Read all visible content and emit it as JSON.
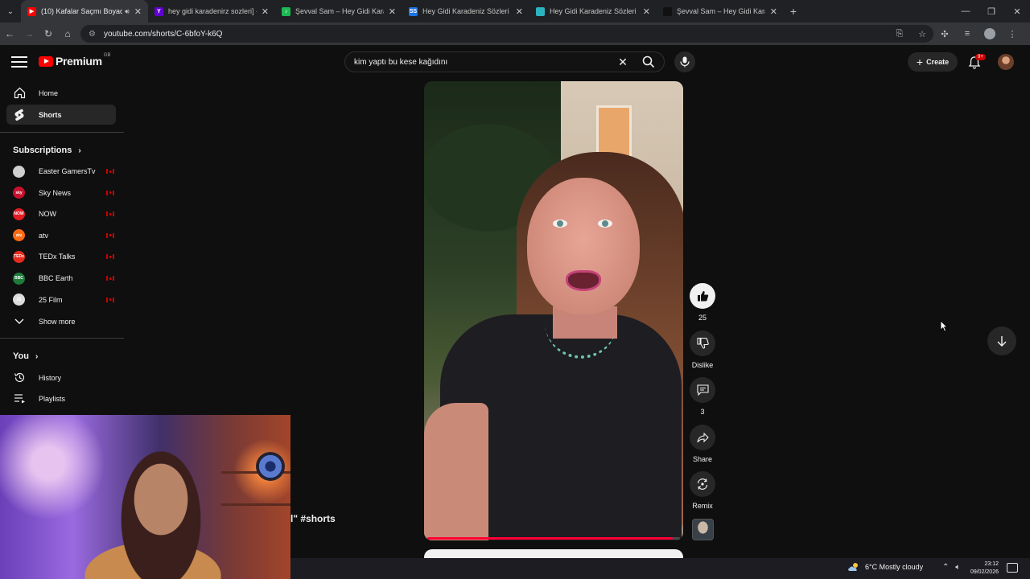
{
  "browser": {
    "tabs": [
      {
        "title": "(10) Kafalar Saçmı Boyadı",
        "favicon_color": "#ff0000",
        "favicon_glyph": "▶",
        "active": true,
        "audio": true
      },
      {
        "title": "hey gidi karadenirz sozleri] - Ya",
        "favicon_color": "#6001d2",
        "favicon_glyph": "Y",
        "active": false
      },
      {
        "title": "Şevval Sam – Hey Gidi Karadeni",
        "favicon_color": "#1db954",
        "favicon_glyph": "♪",
        "active": false
      },
      {
        "title": "Hey Gidi Karadeniz Sözleri - Şe",
        "favicon_color": "#1a73e8",
        "favicon_glyph": "SS",
        "active": false
      },
      {
        "title": "Hey Gidi Karadeniz Sözleri - Ka",
        "favicon_color": "#2bb3c0",
        "favicon_glyph": "",
        "active": false
      },
      {
        "title": "Şevval Sam – Hey Gidi Karadeni",
        "favicon_color": "#111111",
        "favicon_glyph": "",
        "active": false
      }
    ],
    "url": "youtube.com/shorts/C-6bfoY-k6Q"
  },
  "header": {
    "logo_text": "Premium",
    "region": "GB",
    "search_query": "kim yaptı bu kese kağıdını",
    "create_label": "Create",
    "notification_badge": "9+"
  },
  "sidebar": {
    "home_label": "Home",
    "shorts_label": "Shorts",
    "subscriptions_label": "Subscriptions",
    "channels": [
      {
        "name": "Easter GamersTv",
        "color": "#cfcfcf",
        "abbr": ""
      },
      {
        "name": "Sky News",
        "color": "#c8102e",
        "abbr": "sky"
      },
      {
        "name": "NOW",
        "color": "#e31b23",
        "abbr": "NOW"
      },
      {
        "name": "atv",
        "color": "#ff6a13",
        "abbr": "atv"
      },
      {
        "name": "TEDx Talks",
        "color": "#e62b1e",
        "abbr": "TEDx"
      },
      {
        "name": "BBC Earth",
        "color": "#1f7a3a",
        "abbr": "BBC"
      },
      {
        "name": "25 Film",
        "color": "#dddddd",
        "abbr": "25"
      }
    ],
    "show_more_label": "Show more",
    "you_label": "You",
    "history_label": "History",
    "playlists_label": "Playlists"
  },
  "short": {
    "caption": "l\" #shorts",
    "likes": "25",
    "dislike_label": "Dislike",
    "comments": "3",
    "share_label": "Share",
    "remix_label": "Remix",
    "progress": 0.97
  },
  "taskbar": {
    "temperature": "6°C",
    "weather": "Mostly cloudy",
    "time": "23:12",
    "date": "09/02/2026"
  },
  "colors": {
    "accent": "#ff0000",
    "background": "#0f0f0f",
    "surface": "#272727"
  }
}
